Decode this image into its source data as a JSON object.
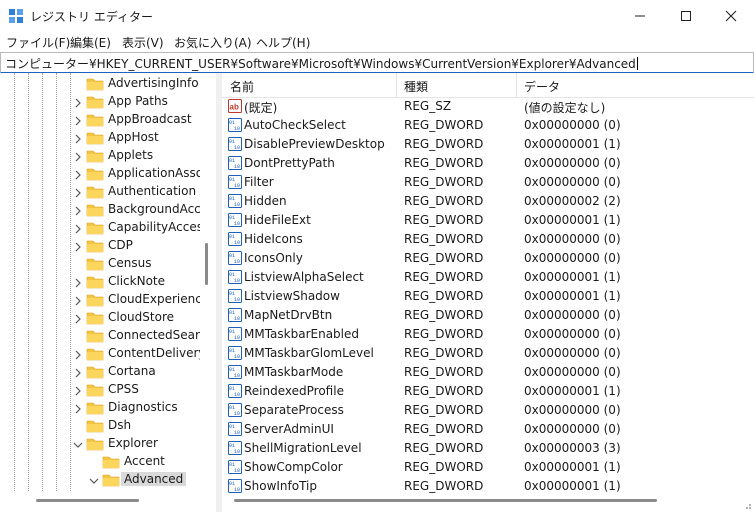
{
  "window": {
    "title": "レジストリ エディター",
    "controls": {
      "minimize": "minimize",
      "maximize": "maximize",
      "close": "close"
    }
  },
  "menu": [
    "ファイル(F)",
    "編集(E)",
    "表示(V)",
    "お気に入り(A)",
    "ヘルプ(H)"
  ],
  "address": "コンピューター¥HKEY_CURRENT_USER¥Software¥Microsoft¥Windows¥CurrentVersion¥Explorer¥Advanced",
  "tree": [
    {
      "label": "AdvertisingInfo",
      "chevron": false
    },
    {
      "label": "App Paths",
      "chevron": true
    },
    {
      "label": "AppBroadcast",
      "chevron": true
    },
    {
      "label": "AppHost",
      "chevron": true
    },
    {
      "label": "Applets",
      "chevron": true
    },
    {
      "label": "ApplicationAssoc",
      "chevron": true
    },
    {
      "label": "Authentication",
      "chevron": true
    },
    {
      "label": "BackgroundAcce",
      "chevron": true
    },
    {
      "label": "CapabilityAccessI",
      "chevron": true
    },
    {
      "label": "CDP",
      "chevron": true
    },
    {
      "label": "Census",
      "chevron": false
    },
    {
      "label": "ClickNote",
      "chevron": true
    },
    {
      "label": "CloudExperienceI",
      "chevron": true
    },
    {
      "label": "CloudStore",
      "chevron": true
    },
    {
      "label": "ConnectedSearch",
      "chevron": false
    },
    {
      "label": "ContentDeliveryN",
      "chevron": true
    },
    {
      "label": "Cortana",
      "chevron": true
    },
    {
      "label": "CPSS",
      "chevron": true
    },
    {
      "label": "Diagnostics",
      "chevron": true
    },
    {
      "label": "Dsh",
      "chevron": false
    },
    {
      "label": "Explorer",
      "chevron": "down"
    },
    {
      "label": "Accent",
      "chevron": false,
      "child": true
    },
    {
      "label": "Advanced",
      "chevron": "down",
      "child": true,
      "selected": true
    }
  ],
  "columns": {
    "name": "名前",
    "type": "種類",
    "data": "データ"
  },
  "values": [
    {
      "name": "(既定)",
      "type": "REG_SZ",
      "data": "(値の設定なし)",
      "icon": "string-value-icon"
    },
    {
      "name": "AutoCheckSelect",
      "type": "REG_DWORD",
      "data": "0x00000000 (0)",
      "icon": "dword-value-icon"
    },
    {
      "name": "DisablePreviewDesktop",
      "type": "REG_DWORD",
      "data": "0x00000001 (1)",
      "icon": "dword-value-icon"
    },
    {
      "name": "DontPrettyPath",
      "type": "REG_DWORD",
      "data": "0x00000000 (0)",
      "icon": "dword-value-icon"
    },
    {
      "name": "Filter",
      "type": "REG_DWORD",
      "data": "0x00000000 (0)",
      "icon": "dword-value-icon"
    },
    {
      "name": "Hidden",
      "type": "REG_DWORD",
      "data": "0x00000002 (2)",
      "icon": "dword-value-icon"
    },
    {
      "name": "HideFileExt",
      "type": "REG_DWORD",
      "data": "0x00000001 (1)",
      "icon": "dword-value-icon"
    },
    {
      "name": "HideIcons",
      "type": "REG_DWORD",
      "data": "0x00000000 (0)",
      "icon": "dword-value-icon"
    },
    {
      "name": "IconsOnly",
      "type": "REG_DWORD",
      "data": "0x00000000 (0)",
      "icon": "dword-value-icon"
    },
    {
      "name": "ListviewAlphaSelect",
      "type": "REG_DWORD",
      "data": "0x00000001 (1)",
      "icon": "dword-value-icon"
    },
    {
      "name": "ListviewShadow",
      "type": "REG_DWORD",
      "data": "0x00000001 (1)",
      "icon": "dword-value-icon"
    },
    {
      "name": "MapNetDrvBtn",
      "type": "REG_DWORD",
      "data": "0x00000000 (0)",
      "icon": "dword-value-icon"
    },
    {
      "name": "MMTaskbarEnabled",
      "type": "REG_DWORD",
      "data": "0x00000000 (0)",
      "icon": "dword-value-icon"
    },
    {
      "name": "MMTaskbarGlomLevel",
      "type": "REG_DWORD",
      "data": "0x00000000 (0)",
      "icon": "dword-value-icon"
    },
    {
      "name": "MMTaskbarMode",
      "type": "REG_DWORD",
      "data": "0x00000000 (0)",
      "icon": "dword-value-icon"
    },
    {
      "name": "ReindexedProfile",
      "type": "REG_DWORD",
      "data": "0x00000001 (1)",
      "icon": "dword-value-icon"
    },
    {
      "name": "SeparateProcess",
      "type": "REG_DWORD",
      "data": "0x00000000 (0)",
      "icon": "dword-value-icon"
    },
    {
      "name": "ServerAdminUI",
      "type": "REG_DWORD",
      "data": "0x00000000 (0)",
      "icon": "dword-value-icon"
    },
    {
      "name": "ShellMigrationLevel",
      "type": "REG_DWORD",
      "data": "0x00000003 (3)",
      "icon": "dword-value-icon"
    },
    {
      "name": "ShowCompColor",
      "type": "REG_DWORD",
      "data": "0x00000001 (1)",
      "icon": "dword-value-icon"
    },
    {
      "name": "ShowInfoTip",
      "type": "REG_DWORD",
      "data": "0x00000001 (1)",
      "icon": "dword-value-icon"
    }
  ],
  "colors": {
    "folder": "#f4c542",
    "accent": "#1f63c0",
    "selection": "#d9d9d9",
    "dword_icon": "#1f5fb8",
    "sz_icon": "#c0392b"
  }
}
